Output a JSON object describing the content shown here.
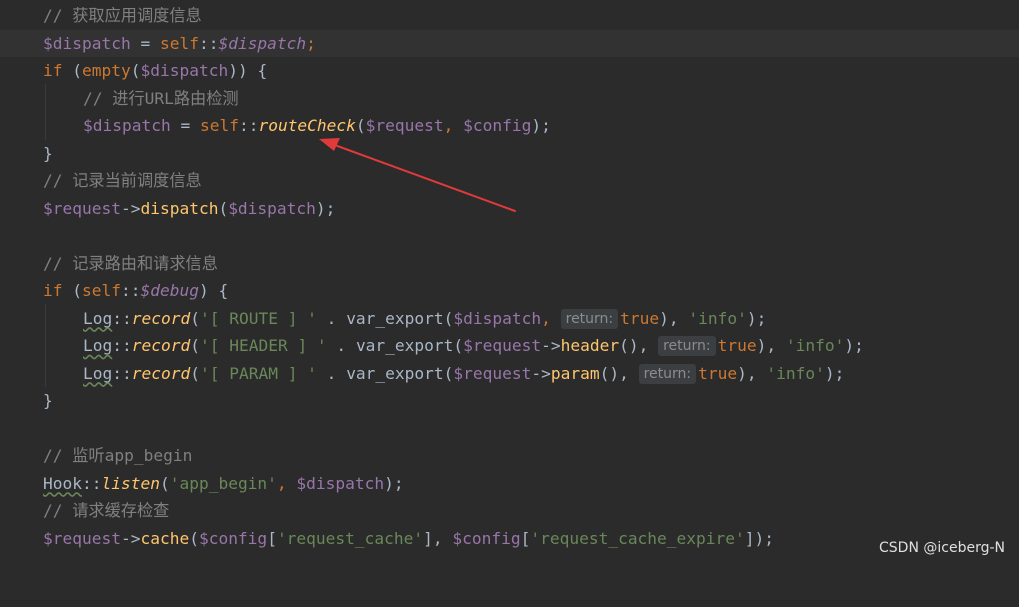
{
  "lines": {
    "l1": {
      "comment": "// 获取应用调度信息"
    },
    "l2": {
      "v1": "$dispatch",
      "op": " = ",
      "self": "self",
      "sep": "::",
      "v2": "$dispatch",
      "end": ";"
    },
    "l3": {
      "kw": "if",
      "p1": " (",
      "fn": "empty",
      "p2": "(",
      "v": "$dispatch",
      "p3": ")) {"
    },
    "l4": {
      "comment": "// 进行URL路由检测"
    },
    "l5": {
      "v1": "$dispatch",
      "op": " = ",
      "self": "self",
      "sep": "::",
      "fn": "routeCheck",
      "p1": "(",
      "v2": "$request",
      "c": ", ",
      "v3": "$config",
      "p2": ");"
    },
    "l6": {
      "text": "}"
    },
    "l7": {
      "comment": "// 记录当前调度信息"
    },
    "l8": {
      "v1": "$request",
      "arrow": "->",
      "fn": "dispatch",
      "p1": "(",
      "v2": "$dispatch",
      "p2": ");"
    },
    "l10": {
      "comment": "// 记录路由和请求信息"
    },
    "l11": {
      "kw": "if",
      "p1": " (",
      "self": "self",
      "sep": "::",
      "v": "$debug",
      "p2": ") {"
    },
    "l12": {
      "cls": "Log",
      "sep": "::",
      "fn": "record",
      "p1": "(",
      "str": "'[ ROUTE ] '",
      "dot": " . ",
      "fn2": "var_export",
      "p2": "(",
      "v": "$dispatch",
      "c": ", ",
      "hint": "return:",
      "kw": "true",
      "p3": "), ",
      "str2": "'info'",
      "p4": ");"
    },
    "l13": {
      "cls": "Log",
      "sep": "::",
      "fn": "record",
      "p1": "(",
      "str": "'[ HEADER ] '",
      "dot": " . ",
      "fn2": "var_export",
      "p2": "(",
      "v": "$request",
      "arrow": "->",
      "fn3": "header",
      "p2b": "(), ",
      "hint": "return:",
      "kw": "true",
      "p3": "), ",
      "str2": "'info'",
      "p4": ");"
    },
    "l14": {
      "cls": "Log",
      "sep": "::",
      "fn": "record",
      "p1": "(",
      "str": "'[ PARAM ] '",
      "dot": " . ",
      "fn2": "var_export",
      "p2": "(",
      "v": "$request",
      "arrow": "->",
      "fn3": "param",
      "p2b": "(), ",
      "hint": "return:",
      "kw": "true",
      "p3": "), ",
      "str2": "'info'",
      "p4": ");"
    },
    "l15": {
      "text": "}"
    },
    "l17": {
      "comment": "// 监听app_begin"
    },
    "l18": {
      "cls": "Hook",
      "sep": "::",
      "fn": "listen",
      "p1": "(",
      "str": "'app_begin'",
      "c": ", ",
      "v": "$dispatch",
      "p2": ");"
    },
    "l19": {
      "comment": "// 请求缓存检查"
    },
    "l20": {
      "v1": "$request",
      "arrow": "->",
      "fn": "cache",
      "p1": "(",
      "v2": "$config",
      "b1": "[",
      "str": "'request_cache'",
      "b2": "], ",
      "v3": "$config",
      "b3": "[",
      "str2": "'request_cache_expire'",
      "b4": "]);"
    }
  },
  "watermark": "CSDN @iceberg-N",
  "colors": {
    "background": "#2b2b2b",
    "annotation_arrow": "#e03a3a"
  },
  "icons": {
    "annotation": "red-arrow"
  }
}
